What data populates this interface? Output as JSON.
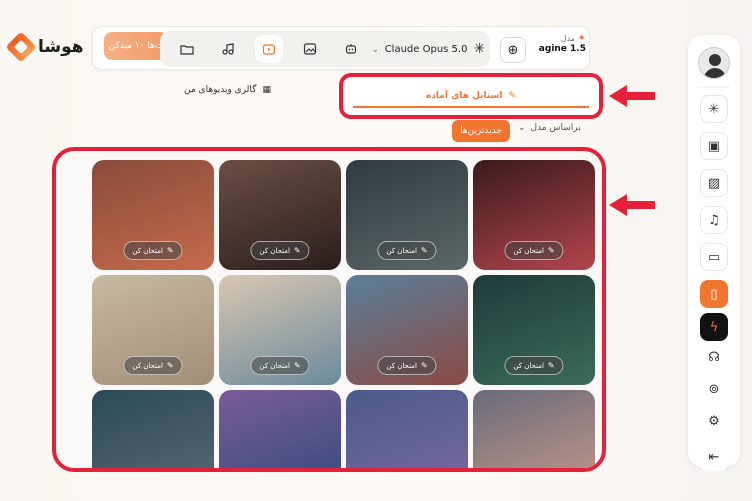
{
  "brand": {
    "name": "هوشا"
  },
  "header": {
    "credit_label": "ت‌ها ۱۰ میدکن",
    "model_label": "مدل",
    "model_value": "agine 1.5",
    "model_selected": "Claude Opus 5.0"
  },
  "tabs": {
    "ready_styles": "استایل های آماده",
    "video_gallery": "گالری ویدیوهای من"
  },
  "filters": {
    "sort_by": "براساس مدل",
    "newest": "جدیدترین‌ها"
  },
  "cards": [
    {
      "try_label": "امتحان کن",
      "colors": [
        "#8a4b3a",
        "#c56a4c"
      ]
    },
    {
      "try_label": "امتحان کن",
      "colors": [
        "#6b4e44",
        "#2a1e1c"
      ]
    },
    {
      "try_label": "امتحان کن",
      "colors": [
        "#2f3b3e",
        "#5b6669"
      ]
    },
    {
      "try_label": "امتحان کن",
      "colors": [
        "#3a1a1a",
        "#b2454d"
      ]
    },
    {
      "try_label": "امتحان کن",
      "colors": [
        "#c8b9a0",
        "#a38e78"
      ]
    },
    {
      "try_label": "امتحان کن",
      "colors": [
        "#d9c7b3",
        "#6b8a9c"
      ]
    },
    {
      "try_label": "امتحان کن",
      "colors": [
        "#5a7f9a",
        "#8a4a44"
      ]
    },
    {
      "try_label": "امتحان کن",
      "colors": [
        "#1e3a3a",
        "#3b6b5a"
      ]
    },
    {
      "try_label": "",
      "colors": [
        "#2a4a58",
        "#5a6a72"
      ]
    },
    {
      "try_label": "",
      "colors": [
        "#7a5c9a",
        "#304a7a"
      ]
    },
    {
      "try_label": "",
      "colors": [
        "#4a5a8a",
        "#7b6aa0"
      ]
    },
    {
      "try_label": "",
      "colors": [
        "#6a6a7a",
        "#c79a8a"
      ]
    }
  ],
  "colors": {
    "accent": "#f0752e",
    "highlight": "#e5213a"
  }
}
